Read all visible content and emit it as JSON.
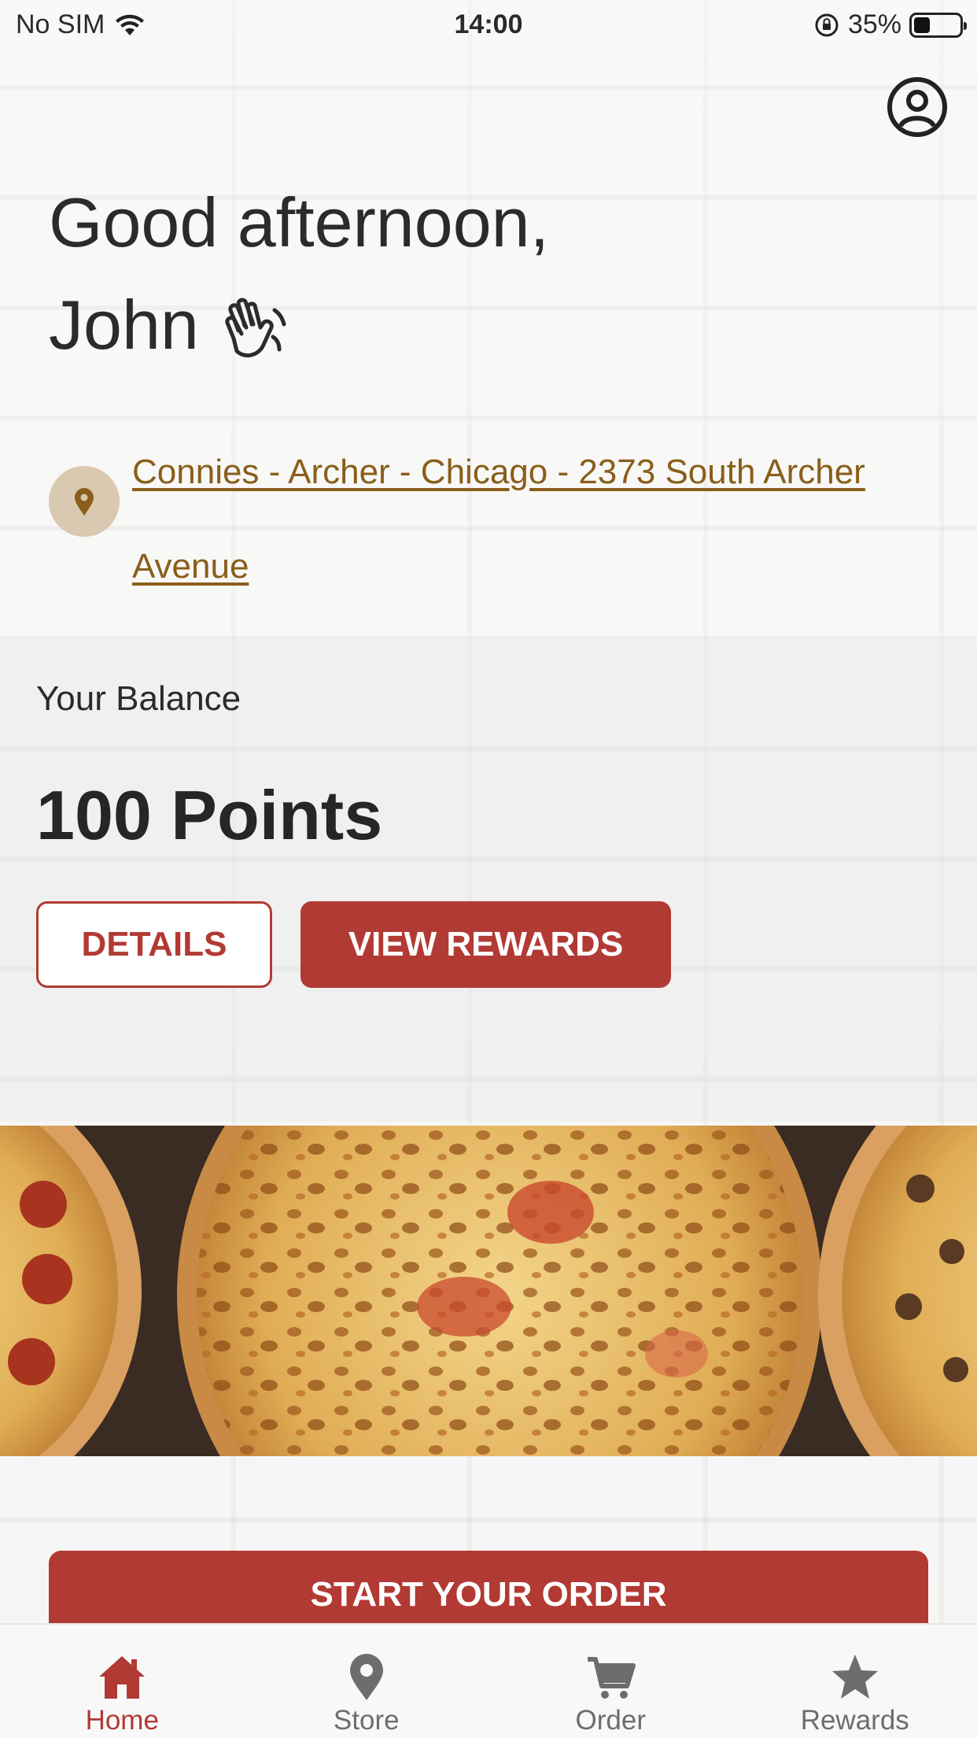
{
  "status_bar": {
    "carrier": "No SIM",
    "time": "14:00",
    "battery": "35%",
    "battery_level": 0.35
  },
  "greeting": {
    "line1": "Good afternoon,",
    "name": "John"
  },
  "store": {
    "name": "Connies - Archer - Chicago - 2373 South Archer Avenue"
  },
  "balance": {
    "label": "Your Balance",
    "value": "100 Points",
    "details_label": "DETAILS",
    "view_rewards_label": "VIEW REWARDS"
  },
  "order": {
    "start_label": "START YOUR ORDER"
  },
  "tabs": [
    {
      "label": "Home",
      "icon": "home-icon",
      "active": true
    },
    {
      "label": "Store",
      "icon": "location-pin-icon",
      "active": false
    },
    {
      "label": "Order",
      "icon": "cart-icon",
      "active": false
    },
    {
      "label": "Rewards",
      "icon": "star-icon",
      "active": false
    }
  ],
  "colors": {
    "accent": "#b23a34",
    "link": "#8a5e1a",
    "pin_bg": "#d9c9b0",
    "tab_inactive": "#6d6d6d"
  }
}
